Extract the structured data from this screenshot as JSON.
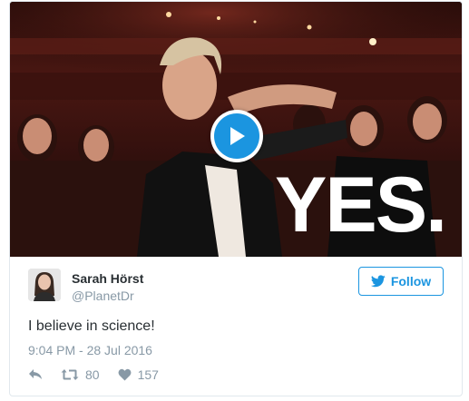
{
  "media": {
    "overlay_text": "YES.",
    "play_icon": "play-icon"
  },
  "author": {
    "display_name": "Sarah Hörst",
    "handle": "@PlanetDr"
  },
  "follow": {
    "label": "Follow",
    "icon": "twitter-bird-icon"
  },
  "tweet": {
    "text": "I believe in science!",
    "timestamp": "9:04 PM - 28 Jul 2016"
  },
  "actions": {
    "reply_icon": "reply-icon",
    "retweet_icon": "retweet-icon",
    "retweet_count": "80",
    "like_icon": "heart-icon",
    "like_count": "157"
  },
  "colors": {
    "accent": "#1b95e0",
    "muted": "#8899a6",
    "text": "#292f33",
    "border": "#e1e8ed"
  }
}
